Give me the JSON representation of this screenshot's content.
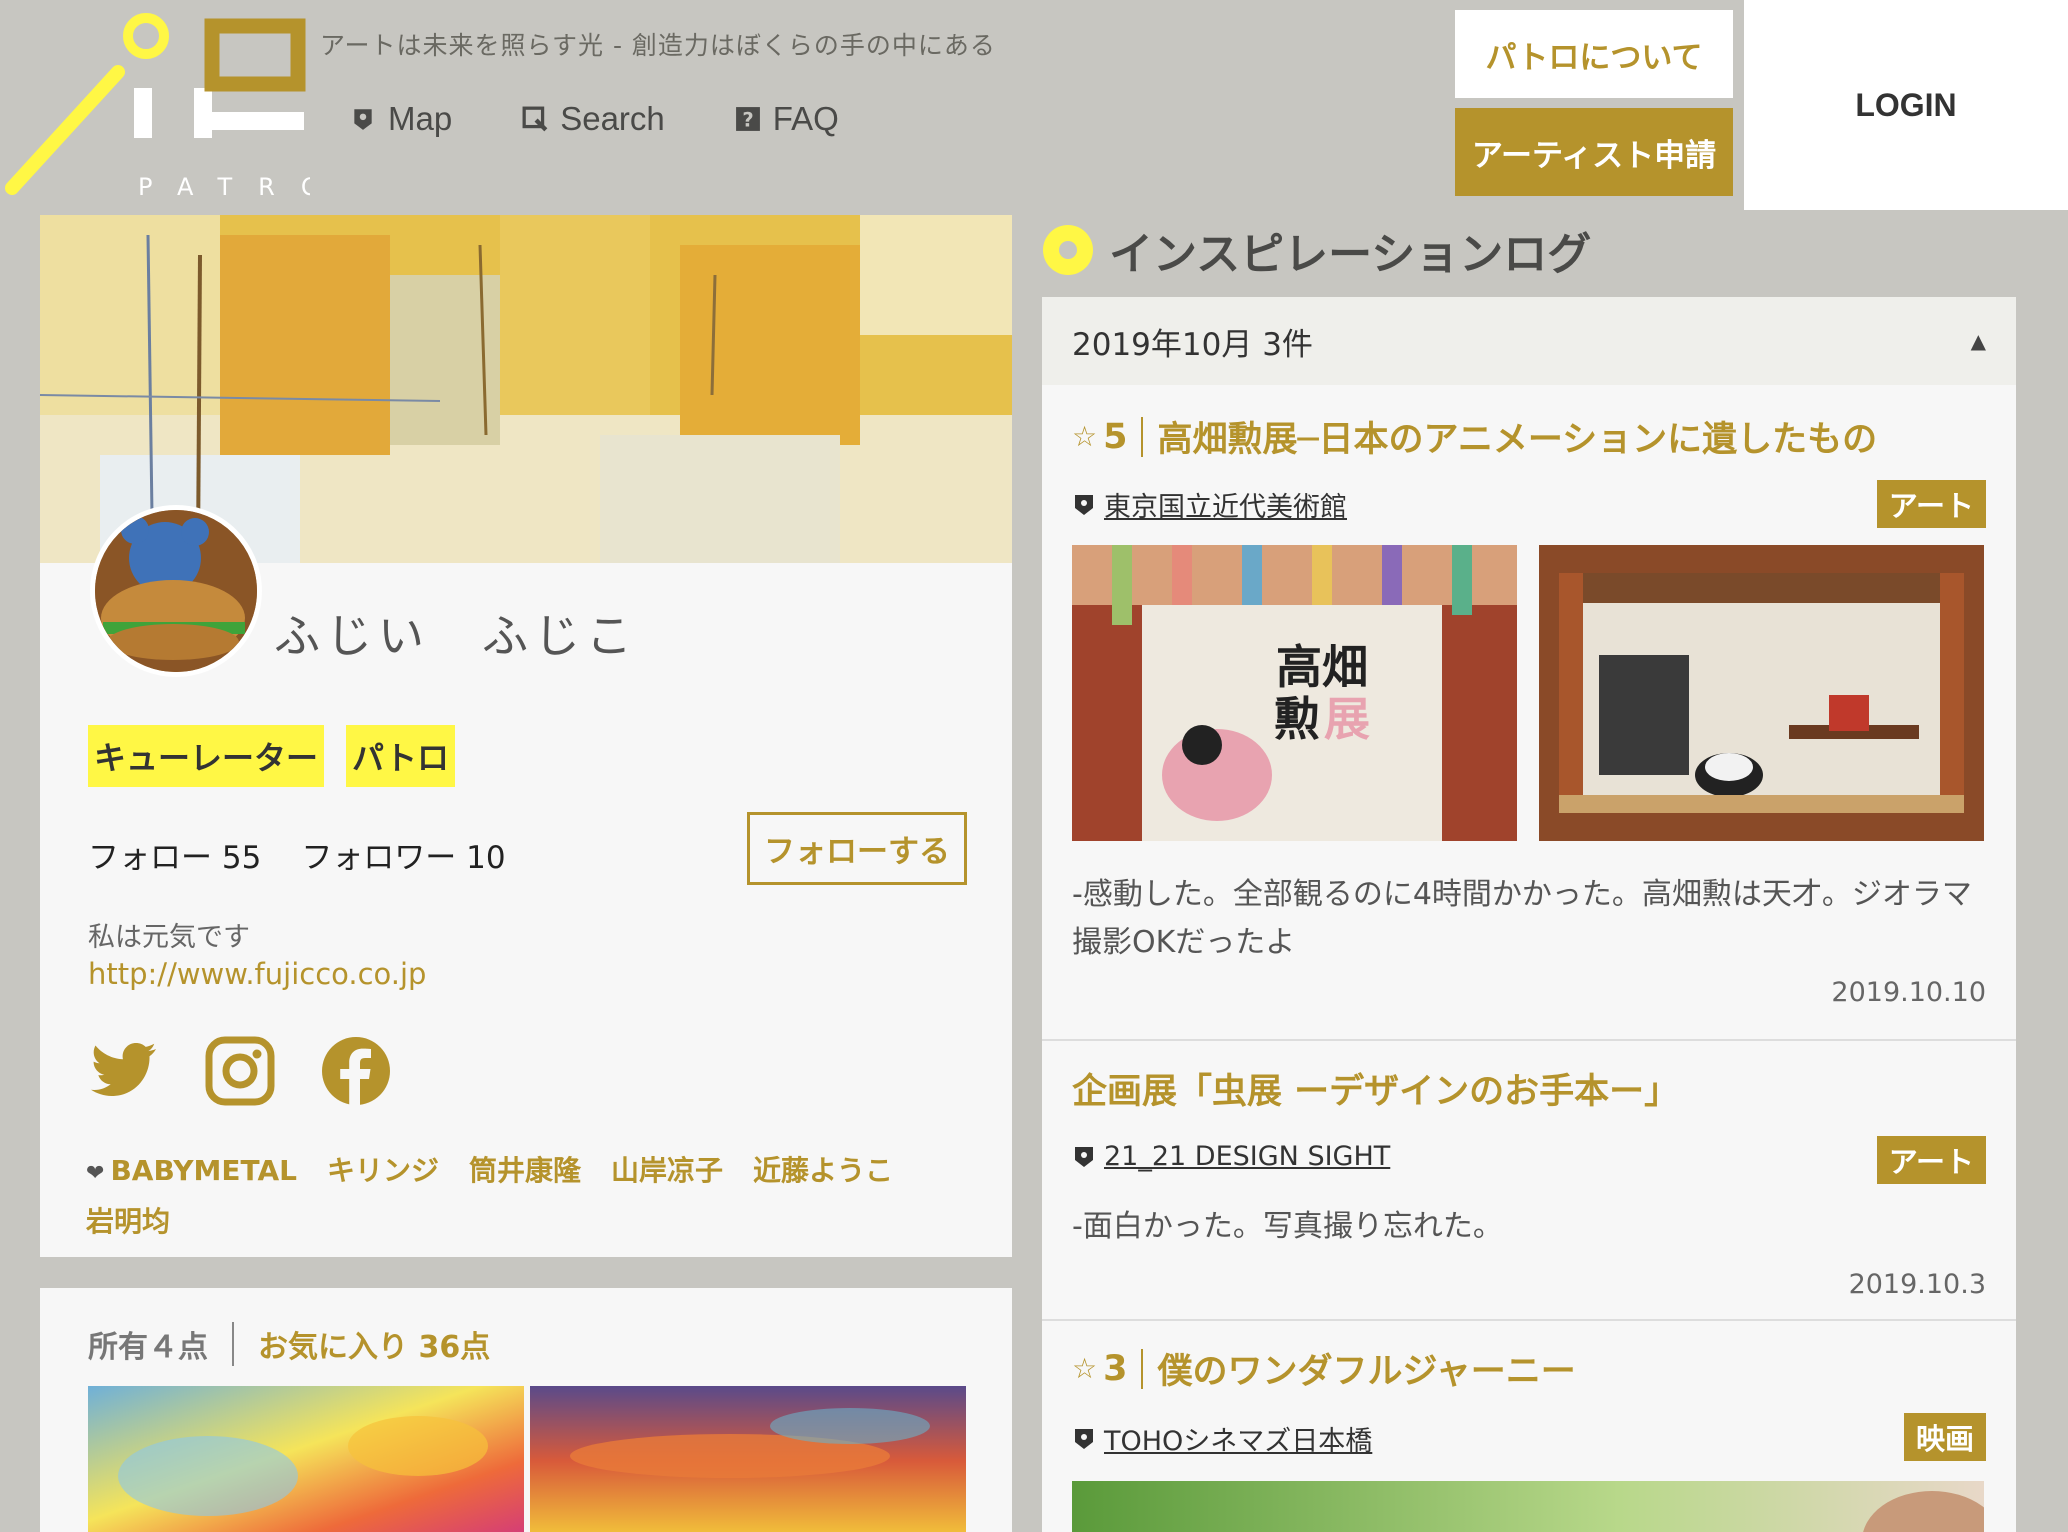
{
  "header": {
    "logo_text": "PATRO",
    "tagline": "アートは未来を照らす光 - 創造力はぼくらの手の中にある",
    "nav": [
      {
        "label": "Map",
        "icon": "map-pin-icon"
      },
      {
        "label": "Search",
        "icon": "search-icon"
      },
      {
        "label": "FAQ",
        "icon": "faq-icon"
      }
    ],
    "about_label": "パトロについて",
    "apply_label": "アーティスト申請",
    "login_label": "LOGIN"
  },
  "profile": {
    "name": "ふじい　ふじこ",
    "roles": [
      "キューレーター",
      "パトロ"
    ],
    "follow_label": "フォロー 55",
    "follower_label": "フォロワー 10",
    "follow_button": "フォローする",
    "bio": "私は元気です",
    "url": "http://www.fujicco.co.jp",
    "social": [
      "twitter-icon",
      "instagram-icon",
      "facebook-icon"
    ],
    "likes": [
      "BABYMETAL",
      "キリンジ",
      "筒井康隆",
      "山岸凉子",
      "近藤ようこ",
      "岩明均"
    ]
  },
  "collection": {
    "owned_label": "所有４点",
    "favorites_label": "お気に入り 36点"
  },
  "log": {
    "title": "インスピレーションログ",
    "month_label": "2019年10月 3件",
    "entries": [
      {
        "rating": "5",
        "title": "高畑勲展─日本のアニメーションに遺したもの",
        "venue": "東京国立近代美術館",
        "category": "アート",
        "poster_text_1": "高畑",
        "poster_text_2": "勲",
        "poster_text_3": "展",
        "text": "-感動した。全部観るのに4時間かかった。高畑勲は天才。ジオラマ撮影OKだったよ",
        "date": "2019.10.10"
      },
      {
        "title": "企画展「虫展 ーデザインのお手本ー」",
        "venue": "21_21 DESIGN SIGHT",
        "category": "アート",
        "text": "-面白かった。写真撮り忘れた。",
        "date": "2019.10.3"
      },
      {
        "rating": "3",
        "title": "僕のワンダフルジャーニー",
        "venue": "TOHOシネマズ日本橋",
        "category": "映画"
      }
    ]
  },
  "colors": {
    "background": "#c7c6c1",
    "gold": "#b5932c",
    "highlight_yellow": "#fff745",
    "card": "#f7f7f7"
  }
}
